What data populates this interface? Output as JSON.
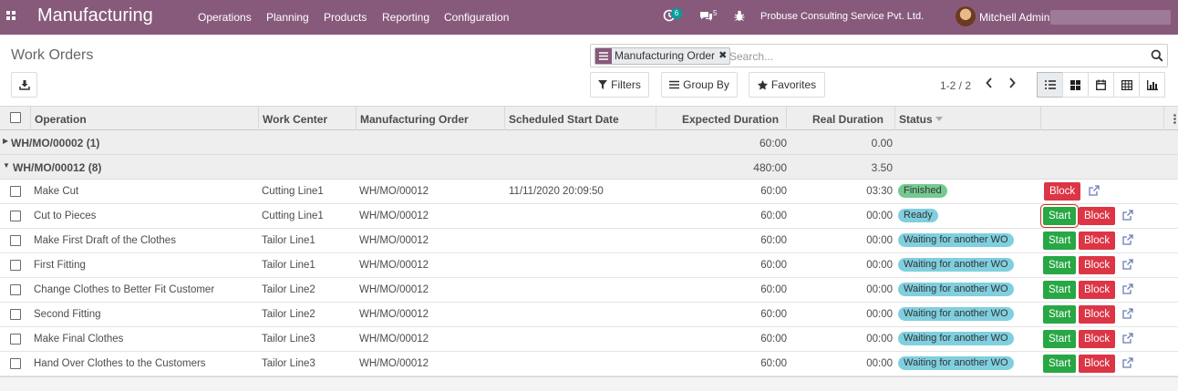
{
  "navbar": {
    "brand": "Manufacturing",
    "menu": [
      "Operations",
      "Planning",
      "Products",
      "Reporting",
      "Configuration"
    ],
    "activity_count": "6",
    "messages_count": "5",
    "company": "Probuse Consulting Service Pvt. Ltd.",
    "user": "Mitchell Admin"
  },
  "control": {
    "title": "Work Orders",
    "facet_label": "Manufacturing Order",
    "search_placeholder": "Search...",
    "filters": "Filters",
    "group_by": "Group By",
    "favorites": "Favorites",
    "pager": "1-2 / 2"
  },
  "columns": {
    "operation": "Operation",
    "work_center": "Work Center",
    "mo": "Manufacturing Order",
    "start": "Scheduled Start Date",
    "expected": "Expected Duration",
    "real": "Real Duration",
    "status": "Status"
  },
  "groups": [
    {
      "label": "WH/MO/00002 (1)",
      "expected": "60:00",
      "real": "0.00",
      "expanded": false
    },
    {
      "label": "WH/MO/00012 (8)",
      "expected": "480:00",
      "real": "3.50",
      "expanded": true
    }
  ],
  "rows": [
    {
      "operation": "Make Cut",
      "work_center": "Cutting Line1",
      "mo": "WH/MO/00012",
      "start": "11/11/2020 20:09:50",
      "expected": "60:00",
      "real": "03:30",
      "status": "Finished",
      "status_kind": "finished",
      "start_btn": "",
      "block_btn": "Block"
    },
    {
      "operation": "Cut to Pieces",
      "work_center": "Cutting Line1",
      "mo": "WH/MO/00012",
      "start": "",
      "expected": "60:00",
      "real": "00:00",
      "status": "Ready",
      "status_kind": "info",
      "start_btn": "Start",
      "block_btn": "Block"
    },
    {
      "operation": "Make First Draft of the Clothes",
      "work_center": "Tailor Line1",
      "mo": "WH/MO/00012",
      "start": "",
      "expected": "60:00",
      "real": "00:00",
      "status": "Waiting for another WO",
      "status_kind": "info",
      "start_btn": "Start",
      "block_btn": "Block"
    },
    {
      "operation": "First Fitting",
      "work_center": "Tailor Line1",
      "mo": "WH/MO/00012",
      "start": "",
      "expected": "60:00",
      "real": "00:00",
      "status": "Waiting for another WO",
      "status_kind": "info",
      "start_btn": "Start",
      "block_btn": "Block"
    },
    {
      "operation": "Change Clothes to Better Fit Customer",
      "work_center": "Tailor Line2",
      "mo": "WH/MO/00012",
      "start": "",
      "expected": "60:00",
      "real": "00:00",
      "status": "Waiting for another WO",
      "status_kind": "info",
      "start_btn": "Start",
      "block_btn": "Block"
    },
    {
      "operation": "Second Fitting",
      "work_center": "Tailor Line2",
      "mo": "WH/MO/00012",
      "start": "",
      "expected": "60:00",
      "real": "00:00",
      "status": "Waiting for another WO",
      "status_kind": "info",
      "start_btn": "Start",
      "block_btn": "Block"
    },
    {
      "operation": "Make Final Clothes",
      "work_center": "Tailor Line3",
      "mo": "WH/MO/00012",
      "start": "",
      "expected": "60:00",
      "real": "00:00",
      "status": "Waiting for another WO",
      "status_kind": "info",
      "start_btn": "Start",
      "block_btn": "Block"
    },
    {
      "operation": "Hand Over Clothes to the Customers",
      "work_center": "Tailor Line3",
      "mo": "WH/MO/00012",
      "start": "",
      "expected": "60:00",
      "real": "00:00",
      "status": "Waiting for another WO",
      "status_kind": "info",
      "start_btn": "Start",
      "block_btn": "Block"
    }
  ],
  "colors": {
    "brand": "#875a7b",
    "start": "#28a745",
    "block": "#dc3545",
    "finished": "#74c990",
    "info": "#7fcfdf"
  }
}
